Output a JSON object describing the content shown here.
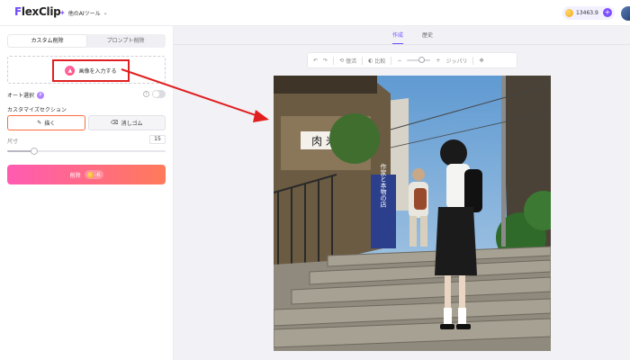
{
  "header": {
    "logo_text": "FlexClip",
    "tools_label": "他のAIツール",
    "credits": "13463.9"
  },
  "left": {
    "mode_tabs": [
      {
        "label": "カスタム削除",
        "active": true
      },
      {
        "label": "プロンプト削除",
        "active": false
      }
    ],
    "upload_label": "画像を入力する",
    "auto_select_label": "オート選択",
    "custom_selection_label": "カスタマイズセクション",
    "brush_tabs": [
      {
        "label": "描く",
        "icon": "brush-icon",
        "active": true
      },
      {
        "label": "消しゴム",
        "icon": "eraser-icon",
        "active": false
      }
    ],
    "size_label": "尺寸",
    "size_value": "15",
    "size_fraction": 0.17,
    "erase_button_label": "削除",
    "erase_cost": "-6"
  },
  "view_tabs": [
    {
      "label": "作成",
      "active": true
    },
    {
      "label": "歴史",
      "active": false
    }
  ],
  "toolbar": {
    "compare_label": "比較",
    "pan_label": "ジッパリ",
    "reset_label": "復活"
  },
  "photo": {
    "sign_top": "肉 米",
    "banner_text": "作家と本物の店"
  },
  "colors": {
    "accent": "#6d4aff",
    "annotation": "#e02020",
    "erase_start": "#ff5bb2",
    "erase_end": "#ff7a5a"
  }
}
